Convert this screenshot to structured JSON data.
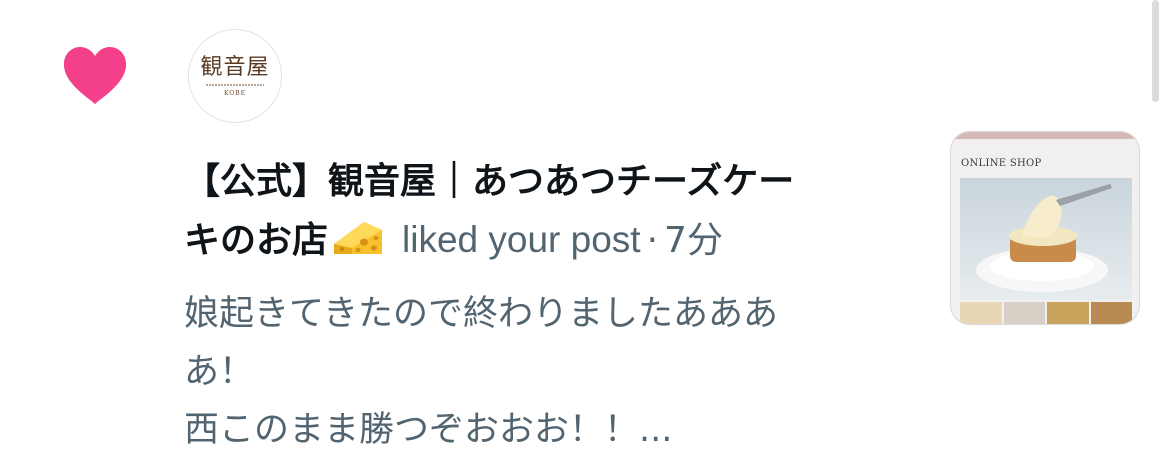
{
  "notification": {
    "type_icon": "heart-icon",
    "type_icon_color": "#f4408a",
    "avatar": {
      "name": "観音屋",
      "subtitle": "KOBE"
    },
    "account_name_line1": "【公式】観音屋｜あつあつチーズケー",
    "account_name_line2": "キのお店",
    "name_emoji": "cheese-icon",
    "action": "liked your post",
    "separator": "·",
    "time": "7分",
    "preview": {
      "line1": "娘起きてきたので終わりましたあああ",
      "line2": "あ！",
      "line3": "西このまま勝つぞおおお！！..."
    },
    "thumbnail": {
      "label": "ONLINE SHOP"
    }
  },
  "colors": {
    "text_primary": "#0f1419",
    "text_secondary": "#536471",
    "heart": "#f4408a"
  }
}
